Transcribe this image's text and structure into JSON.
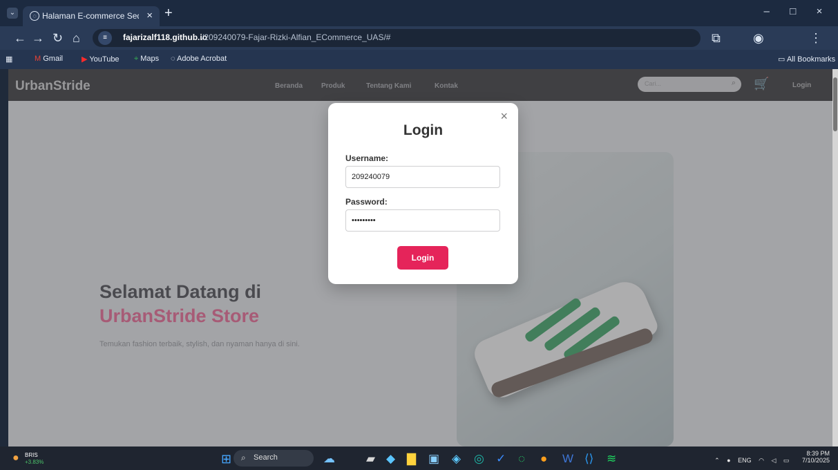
{
  "browser": {
    "tab": {
      "title": "Halaman E-commerce Sederhar",
      "close": "×"
    },
    "new_tab": "+",
    "window_controls": [
      "–",
      "□",
      "×"
    ],
    "address": {
      "host": "fajarizalf118.github.io",
      "path": "/209240079-Fajar-Rizki-Alfian_ECommerce_UAS/#"
    },
    "bookmarks": [
      "Gmail",
      "YouTube",
      "Maps",
      "Adobe Acrobat"
    ],
    "all_bookmarks": "All Bookmarks"
  },
  "site": {
    "brand": "UrbanStride",
    "nav": [
      "Beranda",
      "Produk",
      "Tentang Kami",
      "Kontak"
    ],
    "search_placeholder": "Cari...",
    "login": "Login",
    "hero": {
      "title": "Selamat Datang di",
      "brand": "UrbanStride Store",
      "text": "Temukan fashion terbaik, stylish, dan nyaman hanya di sini."
    }
  },
  "modal": {
    "title": "Login",
    "close": "×",
    "username_label": "Username:",
    "username_value": "209240079",
    "password_label": "Password:",
    "password_value": "•••••••••",
    "button": "Login"
  },
  "taskbar": {
    "ticker": "BRIS",
    "change": "+3.83%",
    "search": "Search",
    "language": "ENG",
    "time": "8:39 PM",
    "date": "7/10/2025"
  }
}
